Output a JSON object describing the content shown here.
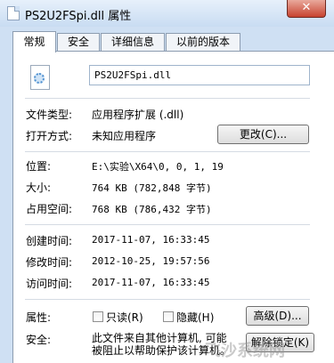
{
  "window": {
    "title": "PS2U2FSpi.dll 属性",
    "close_label": "✕"
  },
  "tabs": [
    {
      "label": "常规",
      "active": true
    },
    {
      "label": "安全",
      "active": false
    },
    {
      "label": "详细信息",
      "active": false
    },
    {
      "label": "以前的版本",
      "active": false
    }
  ],
  "file": {
    "name": "PS2U2FSpi.dll",
    "icon": "dll-file-icon"
  },
  "fields": {
    "type_label": "文件类型:",
    "type_value": "应用程序扩展 (.dll)",
    "open_label": "打开方式:",
    "open_value": "未知应用程序",
    "change_button": "更改(C)...",
    "location_label": "位置:",
    "location_value": "E:\\实验\\X64\\0, 0, 1, 19",
    "size_label": "大小:",
    "size_value": "764 KB (782,848 字节)",
    "disk_label": "占用空间:",
    "disk_value": "768 KB (786,432 字节)",
    "created_label": "创建时间:",
    "created_value": "2017-11-07, 16:33:45",
    "modified_label": "修改时间:",
    "modified_value": "2012-10-25, 19:57:56",
    "accessed_label": "访问时间:",
    "accessed_value": "2017-11-07, 16:33:45",
    "attr_label": "属性:",
    "readonly_label": "只读(R)",
    "hidden_label": "隐藏(H)",
    "advanced_button": "高级(D)...",
    "security_label": "安全:",
    "security_line1": "此文件来自其他计算机, 可能",
    "security_line2": "被阻止以帮助保护该计算机。",
    "unblock_button": "解除锁定(K)"
  },
  "watermark": "飞沙系统网"
}
